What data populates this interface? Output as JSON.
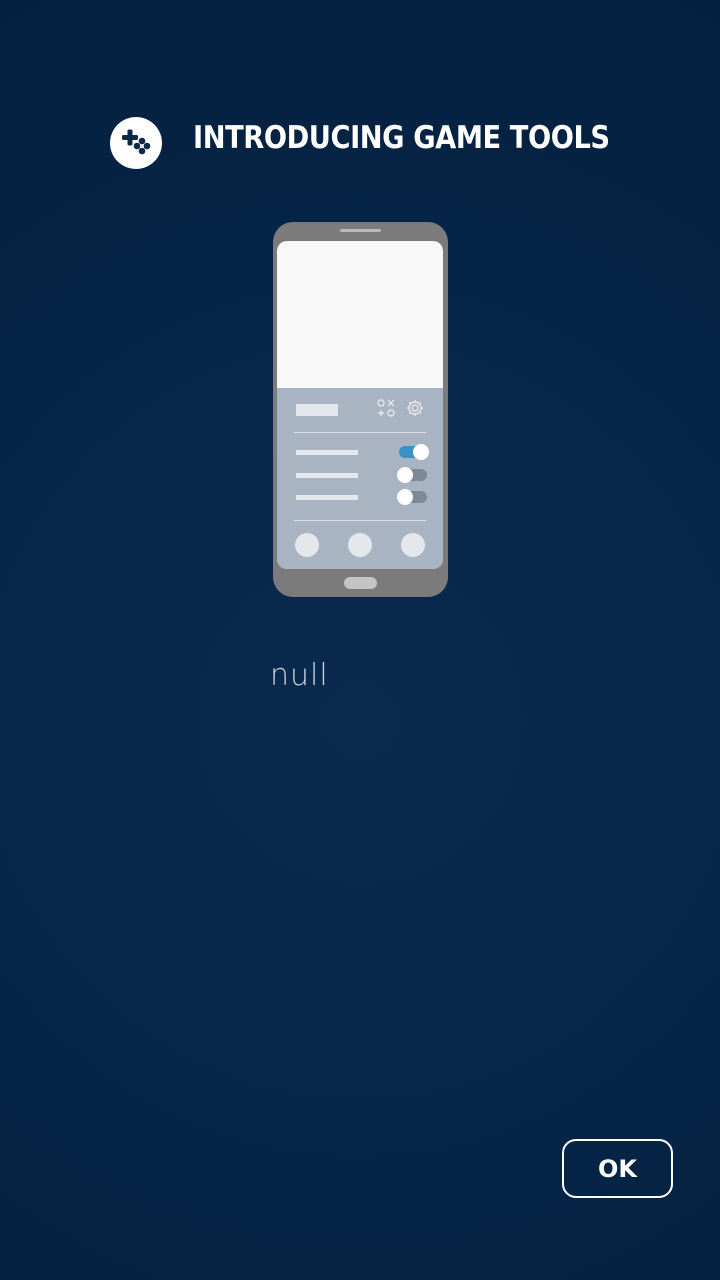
{
  "header": {
    "title": "INTRODUCING GAME TOOLS",
    "logo_icon": "game-launcher-icon"
  },
  "illustration": {
    "description_text": "null",
    "toggles": [
      {
        "state": "on"
      },
      {
        "state": "off"
      },
      {
        "state": "off"
      }
    ]
  },
  "actions": {
    "ok_label": "OK"
  },
  "colors": {
    "background": "#072649",
    "accent_toggle": "#3b92c4"
  }
}
